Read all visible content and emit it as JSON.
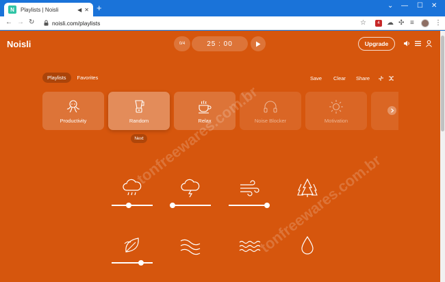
{
  "browser": {
    "tab_title": "Playlists | Noisli",
    "favicon_letter": "N",
    "new_tab": "+",
    "url": "noisli.com/playlists",
    "ext_badge": "4"
  },
  "header": {
    "logo": "Noisli",
    "counter": "0/4",
    "timer": "25 : 00",
    "upgrade": "Upgrade"
  },
  "tabs": [
    {
      "label": "Playlists"
    },
    {
      "label": "Favorites"
    }
  ],
  "actions": {
    "save": "Save",
    "clear": "Clear",
    "share": "Share"
  },
  "playlists": [
    {
      "label": "Productivity",
      "icon": "octopus-icon"
    },
    {
      "label": "Random",
      "icon": "blender-icon"
    },
    {
      "label": "Relax",
      "icon": "coffee-cup-icon"
    },
    {
      "label": "Noise Blocker",
      "icon": "headphones-icon"
    },
    {
      "label": "Motivation",
      "icon": "sun-icon"
    }
  ],
  "next_label": "Next",
  "sounds": [
    {
      "icon": "rain-cloud-icon",
      "volume": 0.4
    },
    {
      "icon": "thunderstorm-icon",
      "volume": 0.0
    },
    {
      "icon": "wind-icon",
      "volume": 1.0
    },
    {
      "icon": "forest-icon",
      "volume": null
    },
    {
      "icon": "leaves-icon",
      "volume": 0.75
    },
    {
      "icon": "water-stream-icon",
      "volume": null
    },
    {
      "icon": "waves-icon",
      "volume": null
    },
    {
      "icon": "drop-icon",
      "volume": null
    }
  ],
  "watermark": "tonfreewares.com.br",
  "colors": {
    "app_bg": "#d6560d",
    "browser_blue": "#1a73d9"
  }
}
